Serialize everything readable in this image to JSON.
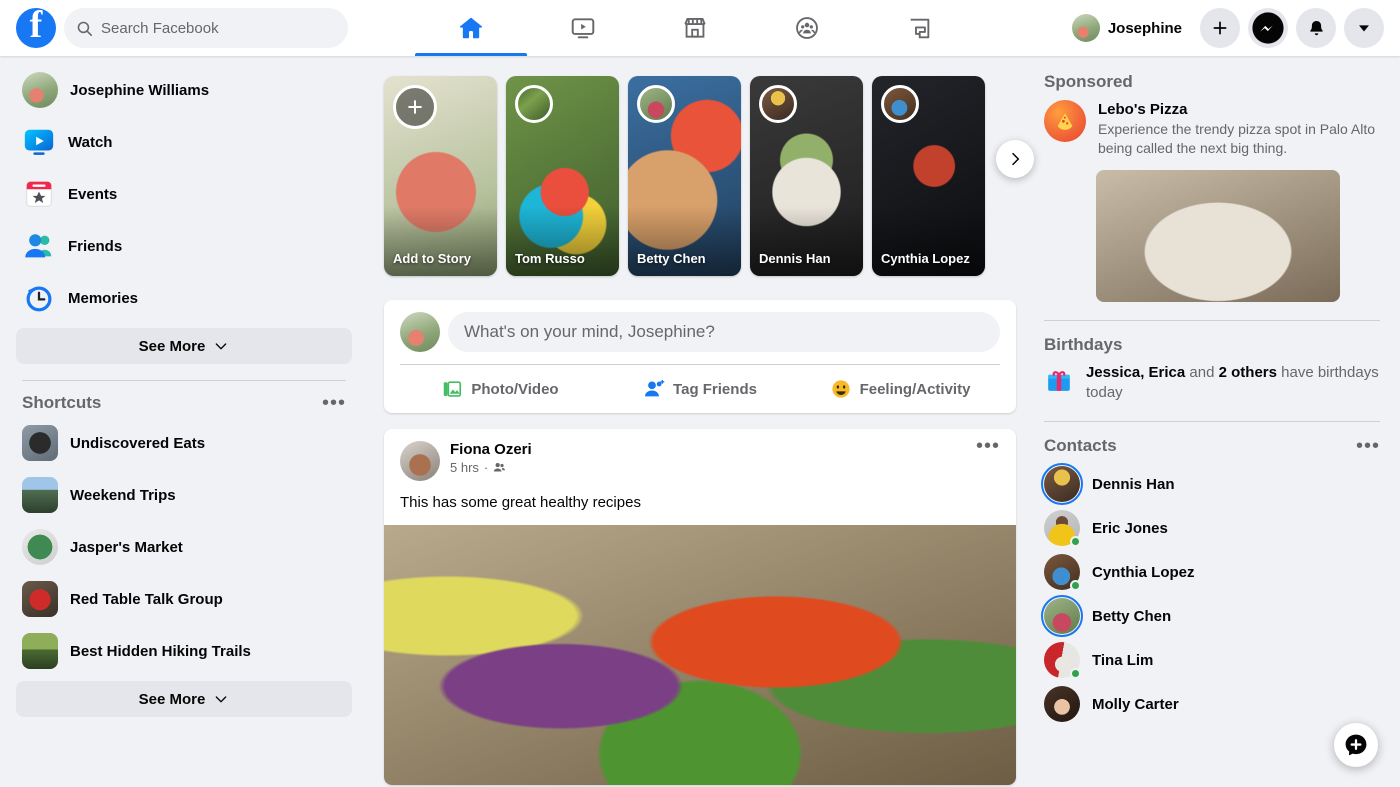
{
  "header": {
    "logo_letter": "f",
    "brand_color": "#1877f2",
    "search": {
      "placeholder": "Search Facebook",
      "value": "",
      "icon": "search-icon"
    },
    "nav_tabs": [
      {
        "name": "home",
        "icon": "home-icon",
        "active": true
      },
      {
        "name": "watch",
        "icon": "video-icon",
        "active": false
      },
      {
        "name": "marketplace",
        "icon": "storefront-icon",
        "active": false
      },
      {
        "name": "groups",
        "icon": "groups-icon",
        "active": false
      },
      {
        "name": "gaming",
        "icon": "gaming-icon",
        "active": false
      }
    ],
    "profile_name": "Josephine",
    "actions": [
      {
        "name": "create",
        "icon": "plus-icon"
      },
      {
        "name": "messenger",
        "icon": "messenger-icon"
      },
      {
        "name": "notifications",
        "icon": "bell-icon"
      },
      {
        "name": "account-menu",
        "icon": "chevron-down-icon"
      }
    ]
  },
  "sidebar": {
    "items": [
      {
        "label": "Josephine Williams",
        "icon": "avatar"
      },
      {
        "label": "Watch",
        "icon": "watch-icon"
      },
      {
        "label": "Events",
        "icon": "events-icon"
      },
      {
        "label": "Friends",
        "icon": "friends-icon"
      },
      {
        "label": "Memories",
        "icon": "memories-icon"
      }
    ],
    "see_more": "See More",
    "shortcuts_title": "Shortcuts",
    "shortcuts": [
      {
        "label": "Undiscovered Eats"
      },
      {
        "label": "Weekend Trips"
      },
      {
        "label": "Jasper's Market"
      },
      {
        "label": "Red Table Talk Group"
      },
      {
        "label": "Best Hidden Hiking Trails"
      }
    ],
    "shortcuts_see_more": "See More"
  },
  "stories": {
    "next_label": "Next",
    "cards": [
      {
        "name": "Add to Story",
        "type": "add"
      },
      {
        "name": "Tom Russo",
        "type": "story"
      },
      {
        "name": "Betty Chen",
        "type": "story"
      },
      {
        "name": "Dennis Han",
        "type": "story"
      },
      {
        "name": "Cynthia Lopez",
        "type": "story"
      }
    ]
  },
  "composer": {
    "placeholder": "What's on your mind, Josephine?",
    "actions": [
      {
        "label": "Photo/Video",
        "icon": "photo-icon",
        "color": "#45bd62"
      },
      {
        "label": "Tag Friends",
        "icon": "tag-icon",
        "color": "#1877f2"
      },
      {
        "label": "Feeling/Activity",
        "icon": "emoji-icon",
        "color": "#f7b928"
      }
    ]
  },
  "post": {
    "author": "Fiona Ozeri",
    "time": "5 hrs",
    "audience_icon": "friends-audience-icon",
    "menu_icon": "more-options-icon",
    "text": "This has some great healthy recipes"
  },
  "rail": {
    "sponsored_title": "Sponsored",
    "ad": {
      "title": "Lebo's Pizza",
      "description": "Experience the trendy pizza spot in Palo Alto being called the next big thing.",
      "logo_icon": "pizza-logo-icon"
    },
    "birthdays_title": "Birthdays",
    "birthday": {
      "icon": "gift-icon",
      "names": "Jessica, Erica",
      "connector": " and ",
      "others": "2 others",
      "suffix": " have birthdays today"
    },
    "contacts_title": "Contacts",
    "contacts_menu_icon": "more-options-icon",
    "contacts": [
      {
        "name": "Dennis Han",
        "ring": true,
        "online": false
      },
      {
        "name": "Eric Jones",
        "ring": false,
        "online": true
      },
      {
        "name": "Cynthia Lopez",
        "ring": false,
        "online": true
      },
      {
        "name": "Betty Chen",
        "ring": true,
        "online": false
      },
      {
        "name": "Tina Lim",
        "ring": false,
        "online": true
      },
      {
        "name": "Molly Carter",
        "ring": false,
        "online": false
      }
    ],
    "fab_icon": "new-message-icon"
  }
}
